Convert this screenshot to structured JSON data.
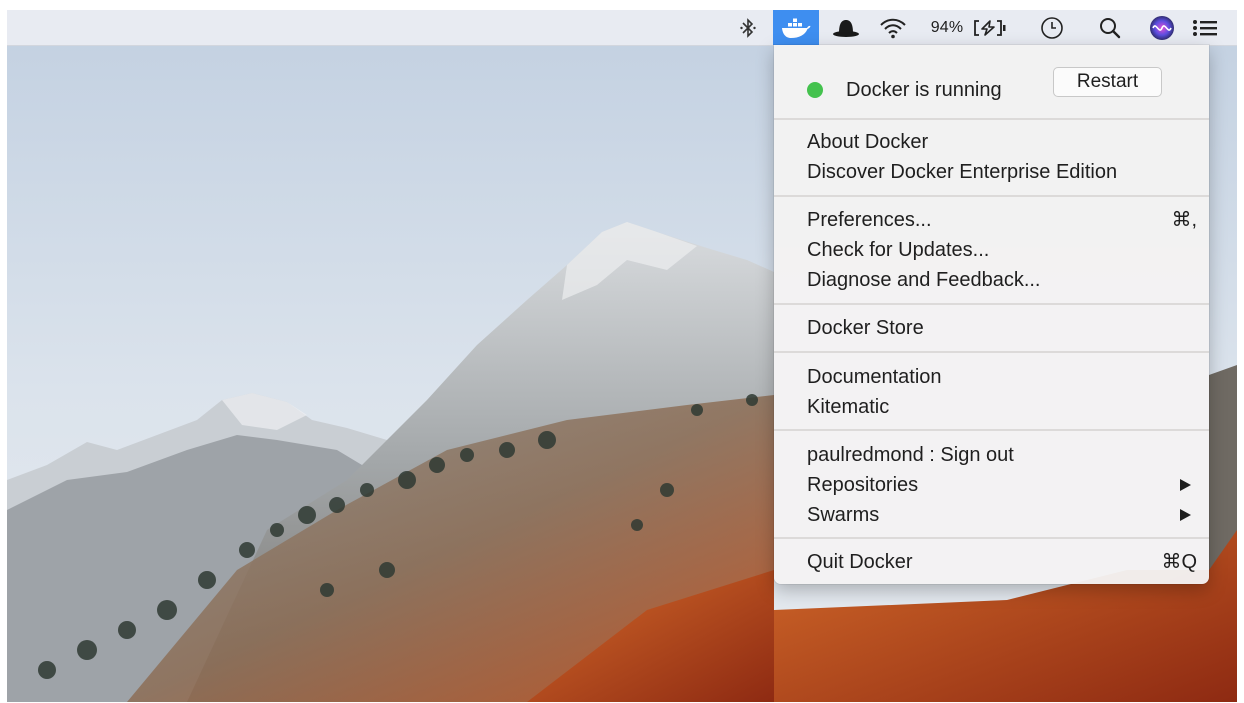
{
  "menubar": {
    "icons": [
      "bluetooth-icon",
      "docker-whale-icon",
      "bowler-hat-icon",
      "wifi-icon",
      "battery-charging-icon",
      "time-machine-icon",
      "spotlight-search-icon",
      "siri-icon",
      "notification-center-icon"
    ],
    "battery_percent": "94%"
  },
  "menu": {
    "status_text": "Docker is running",
    "status_color": "#44c24e",
    "restart_label": "Restart",
    "about": "About Docker",
    "discover": "Discover Docker Enterprise Edition",
    "preferences": "Preferences...",
    "preferences_shortcut": "⌘,",
    "check_updates": "Check for Updates...",
    "diagnose": "Diagnose and Feedback...",
    "store": "Docker Store",
    "documentation": "Documentation",
    "kitematic": "Kitematic",
    "account": "paulredmond : Sign out",
    "repositories": "Repositories",
    "swarms": "Swarms",
    "quit": "Quit Docker",
    "quit_shortcut": "⌘Q"
  },
  "colors": {
    "accent": "#3e8ef0",
    "menubar_bg": "#e8ebf2"
  }
}
